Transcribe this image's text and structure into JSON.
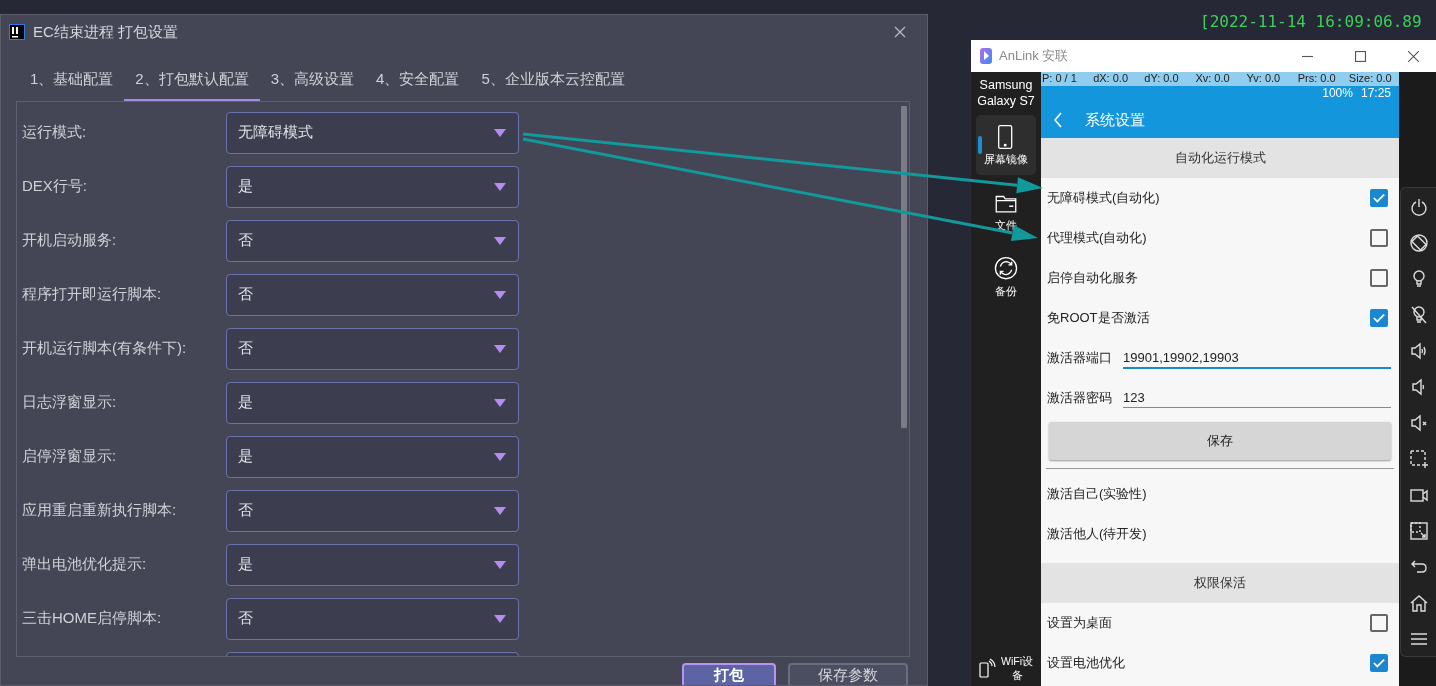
{
  "log_line": "[2022-11-14 16:09:06.89",
  "dialog": {
    "title": "EC结束进程 打包设置",
    "tabs": [
      {
        "label": "1、基础配置",
        "selected": false
      },
      {
        "label": "2、打包默认配置",
        "selected": true
      },
      {
        "label": "3、高级设置",
        "selected": false
      },
      {
        "label": "4、安全配置",
        "selected": false
      },
      {
        "label": "5、企业版本云控配置",
        "selected": false
      }
    ],
    "settings": [
      {
        "label": "运行模式:",
        "value": "无障碍模式"
      },
      {
        "label": "DEX行号:",
        "value": "是"
      },
      {
        "label": "开机启动服务:",
        "value": "否"
      },
      {
        "label": "程序打开即运行脚本:",
        "value": "否"
      },
      {
        "label": "开机运行脚本(有条件下):",
        "value": "否"
      },
      {
        "label": "日志浮窗显示:",
        "value": "是"
      },
      {
        "label": "启停浮窗显示:",
        "value": "是"
      },
      {
        "label": "应用重启重新执行脚本:",
        "value": "否"
      },
      {
        "label": "弹出电池优化提示:",
        "value": "是"
      },
      {
        "label": "三击HOME启停脚本:",
        "value": "否"
      }
    ],
    "buttons": [
      {
        "label": "打包",
        "primary": true
      },
      {
        "label": "保存参数",
        "primary": false
      }
    ]
  },
  "anlink": {
    "title": "AnLink 安联",
    "device_name": "Samsung Galaxy S7",
    "nav": [
      {
        "label": "屏幕镜像",
        "selected": true
      },
      {
        "label": "文件",
        "selected": false
      },
      {
        "label": "备份",
        "selected": false
      }
    ],
    "wifi_label": "WiFi设备",
    "touch_info": [
      "P: 0 / 1",
      "dX: 0.0",
      "dY: 0.0",
      "Xv: 0.0",
      "Yv: 0.0",
      "Prs: 0.0",
      "Size: 0.0"
    ],
    "status": {
      "battery": "100%",
      "time": "17:25"
    },
    "screen_title": "系统设置",
    "items": [
      {
        "kind": "header",
        "label": "自动化运行模式"
      },
      {
        "kind": "checkbox",
        "label": "无障碍模式(自动化)",
        "checked": true
      },
      {
        "kind": "checkbox",
        "label": "代理模式(自动化)",
        "checked": false
      },
      {
        "kind": "checkbox",
        "label": "启停自动化服务",
        "checked": false
      },
      {
        "kind": "checkbox",
        "label": "免ROOT是否激活",
        "checked": true
      },
      {
        "kind": "field",
        "label": "激活器端口",
        "value": "19901,19902,19903",
        "focused": true
      },
      {
        "kind": "field",
        "label": "激活器密码",
        "value": "123",
        "focused": false
      },
      {
        "kind": "button",
        "label": "保存"
      },
      {
        "kind": "text",
        "label": "激活自己(实验性)"
      },
      {
        "kind": "text",
        "label": "激活他人(待开发)"
      },
      {
        "kind": "header",
        "label": "权限保活"
      },
      {
        "kind": "checkbox",
        "label": "设置为桌面",
        "checked": false
      },
      {
        "kind": "checkbox",
        "label": "设置电池优化",
        "checked": true
      }
    ]
  }
}
